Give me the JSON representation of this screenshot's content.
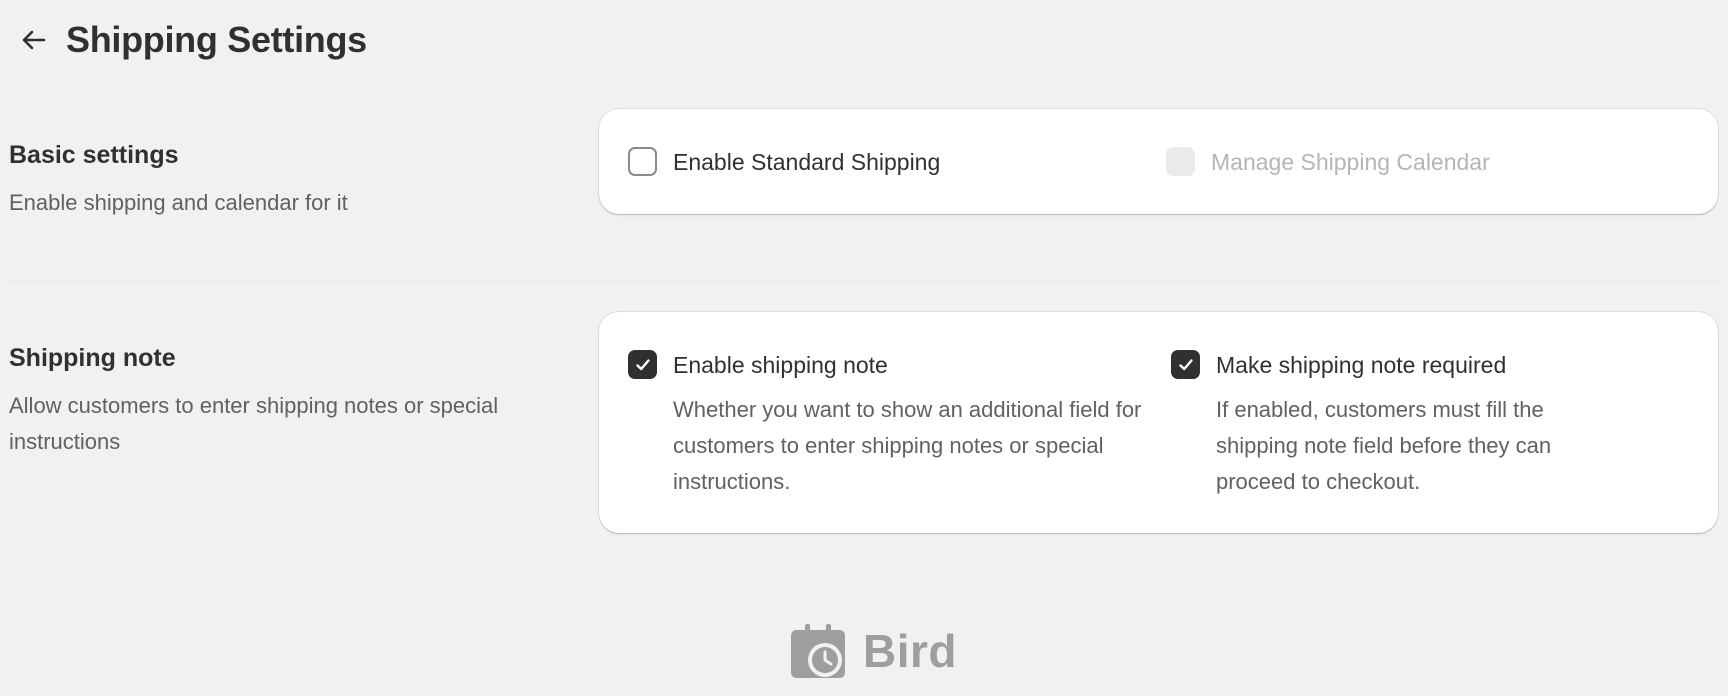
{
  "header": {
    "title": "Shipping Settings",
    "back_icon": "arrow-left-icon"
  },
  "sections": [
    {
      "heading": "Basic settings",
      "description": "Enable shipping and calendar for it",
      "options": [
        {
          "label": "Enable Standard Shipping",
          "checked": false,
          "disabled": false
        },
        {
          "label": "Manage Shipping Calendar",
          "checked": false,
          "disabled": true
        }
      ]
    },
    {
      "heading": "Shipping note",
      "description": "Allow customers to enter shipping notes or special instructions",
      "options": [
        {
          "label": "Enable shipping note",
          "help": "Whether you want to show an additional field for customers to enter shipping notes or special instructions.",
          "checked": true,
          "disabled": false
        },
        {
          "label": "Make shipping note required",
          "help": "If enabled, customers must fill the shipping note field before they can proceed to checkout.",
          "checked": true,
          "disabled": false
        }
      ]
    }
  ],
  "footer": {
    "brand": "Bird",
    "logo_icon": "calendar-clock-icon"
  },
  "colors": {
    "background": "#f1f1f1",
    "card": "#ffffff",
    "text_primary": "#303030",
    "text_secondary": "#616161",
    "text_disabled": "#b5b5b5",
    "checkbox_checked": "#303030"
  }
}
